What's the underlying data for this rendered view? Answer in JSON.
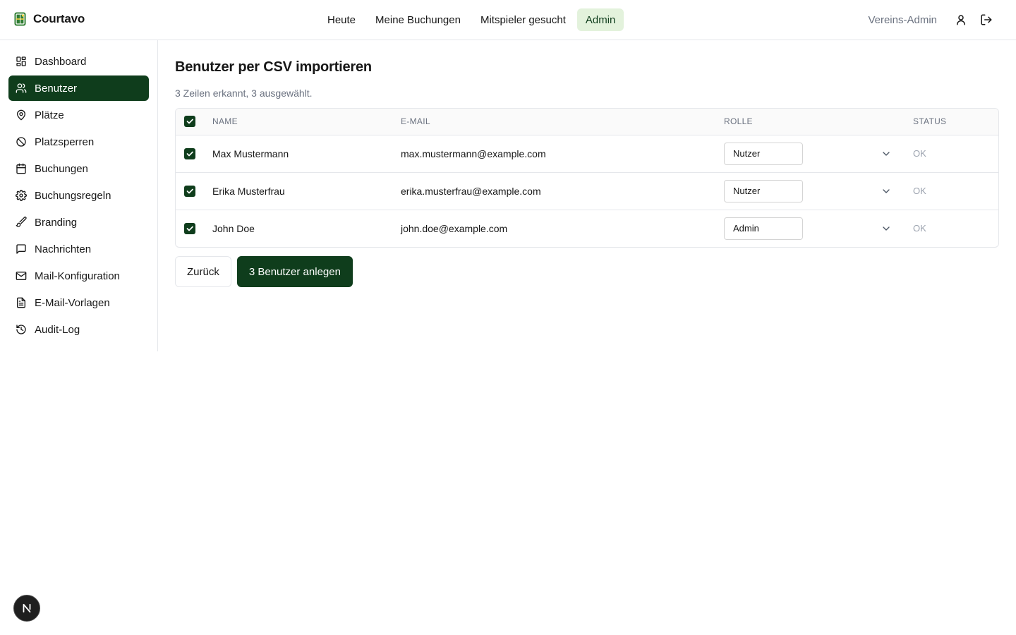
{
  "app": {
    "name": "Courtavo",
    "logo_icon": "tennis-court-icon"
  },
  "topnav": {
    "items": [
      {
        "label": "Heute",
        "active": false
      },
      {
        "label": "Meine Buchungen",
        "active": false
      },
      {
        "label": "Mitspieler gesucht",
        "active": false
      },
      {
        "label": "Admin",
        "active": true
      }
    ]
  },
  "user": {
    "label": "Vereins-Admin",
    "profile_icon": "user-icon",
    "logout_icon": "logout-icon"
  },
  "sidebar": {
    "items": [
      {
        "label": "Dashboard",
        "icon": "dashboard-icon",
        "active": false
      },
      {
        "label": "Benutzer",
        "icon": "users-icon",
        "active": true
      },
      {
        "label": "Plätze",
        "icon": "map-pin-icon",
        "active": false
      },
      {
        "label": "Platzsperren",
        "icon": "ban-icon",
        "active": false
      },
      {
        "label": "Buchungen",
        "icon": "calendar-icon",
        "active": false
      },
      {
        "label": "Buchungsregeln",
        "icon": "gear-icon",
        "active": false
      },
      {
        "label": "Branding",
        "icon": "brush-icon",
        "active": false
      },
      {
        "label": "Nachrichten",
        "icon": "message-icon",
        "active": false
      },
      {
        "label": "Mail-Konfiguration",
        "icon": "mail-icon",
        "active": false
      },
      {
        "label": "E-Mail-Vorlagen",
        "icon": "file-text-icon",
        "active": false
      },
      {
        "label": "Audit-Log",
        "icon": "history-icon",
        "active": false
      }
    ]
  },
  "main": {
    "title": "Benutzer per CSV importieren",
    "summary": "3 Zeilen erkannt, 3 ausgewählt.",
    "table": {
      "headers": {
        "name": "NAME",
        "email": "E-MAIL",
        "role": "ROLLE",
        "status": "STATUS"
      },
      "all_selected": true,
      "rows": [
        {
          "selected": true,
          "name": "Max Mustermann",
          "email": "max.mustermann@example.com",
          "role": "Nutzer",
          "status": "OK"
        },
        {
          "selected": true,
          "name": "Erika Musterfrau",
          "email": "erika.musterfrau@example.com",
          "role": "Nutzer",
          "status": "OK"
        },
        {
          "selected": true,
          "name": "John Doe",
          "email": "john.doe@example.com",
          "role": "Admin",
          "status": "OK"
        }
      ]
    },
    "actions": {
      "back": "Zurück",
      "create": "3 Benutzer anlegen"
    }
  },
  "dev_badge": {
    "letter": "N"
  },
  "colors": {
    "primary": "#0f3d1c",
    "active_tab_bg": "#e3f2dc",
    "muted": "#6b7280",
    "border": "#e5e7eb"
  }
}
